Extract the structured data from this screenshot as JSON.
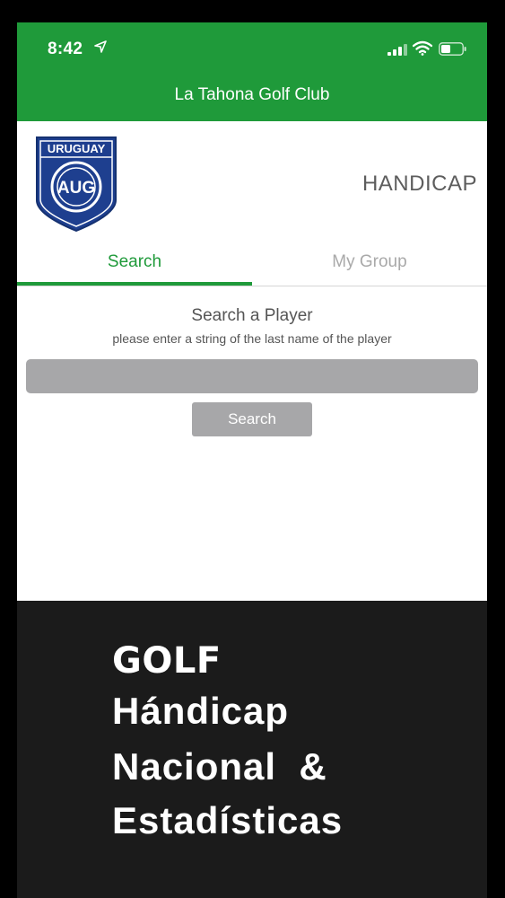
{
  "status_bar": {
    "time": "8:42",
    "location_icon": "location-arrow-icon",
    "signal_icon": "cellular-signal-icon",
    "wifi_icon": "wifi-icon",
    "battery_icon": "battery-icon"
  },
  "nav": {
    "title": "La Tahona Golf Club"
  },
  "header": {
    "logo_text_top": "URUGUAY",
    "logo_monogram": "AUG",
    "section_title": "HANDICAP"
  },
  "tabs": [
    {
      "label": "Search",
      "active": true
    },
    {
      "label": "My Group",
      "active": false
    }
  ],
  "search": {
    "title": "Search a Player",
    "subtitle": "please enter a string of the last name of the player",
    "input_value": "",
    "input_placeholder": "",
    "button_label": "Search"
  },
  "promo": {
    "line1": "GOLF",
    "line2": "Hándicap",
    "line3": "Nacional  &",
    "line4": "Estadísticas"
  },
  "colors": {
    "brand_green": "#1f9a3a",
    "logo_blue": "#1e3f8f",
    "input_gray": "#a7a7a9",
    "promo_bg": "#1b1b1b"
  }
}
